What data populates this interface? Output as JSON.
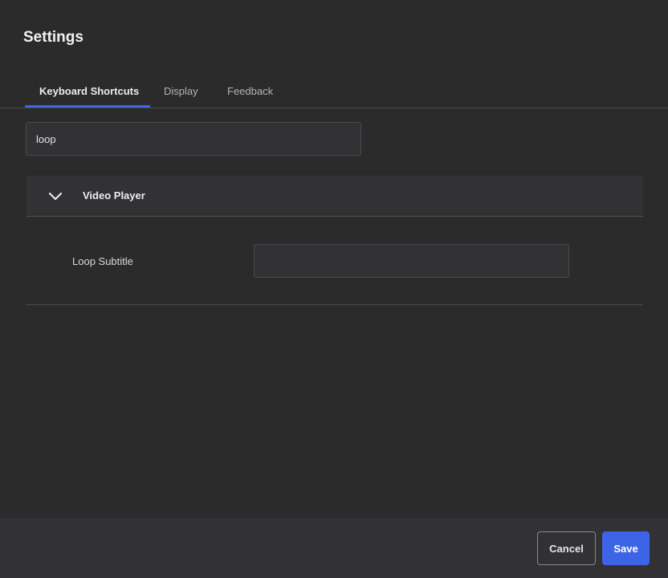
{
  "dialog": {
    "title": "Settings"
  },
  "tabs": [
    {
      "label": "Keyboard Shortcuts",
      "active": true
    },
    {
      "label": "Display",
      "active": false
    },
    {
      "label": "Feedback",
      "active": false
    }
  ],
  "search": {
    "value": "loop",
    "placeholder": ""
  },
  "section": {
    "label": "Video Player",
    "expanded": true,
    "icon": "chevron-down-icon",
    "rows": [
      {
        "label": "Loop Subtitle",
        "shortcut": ""
      }
    ]
  },
  "footer": {
    "cancel_label": "Cancel",
    "save_label": "Save"
  },
  "colors": {
    "accent": "#3d63e6",
    "background": "#2b2b2c"
  }
}
